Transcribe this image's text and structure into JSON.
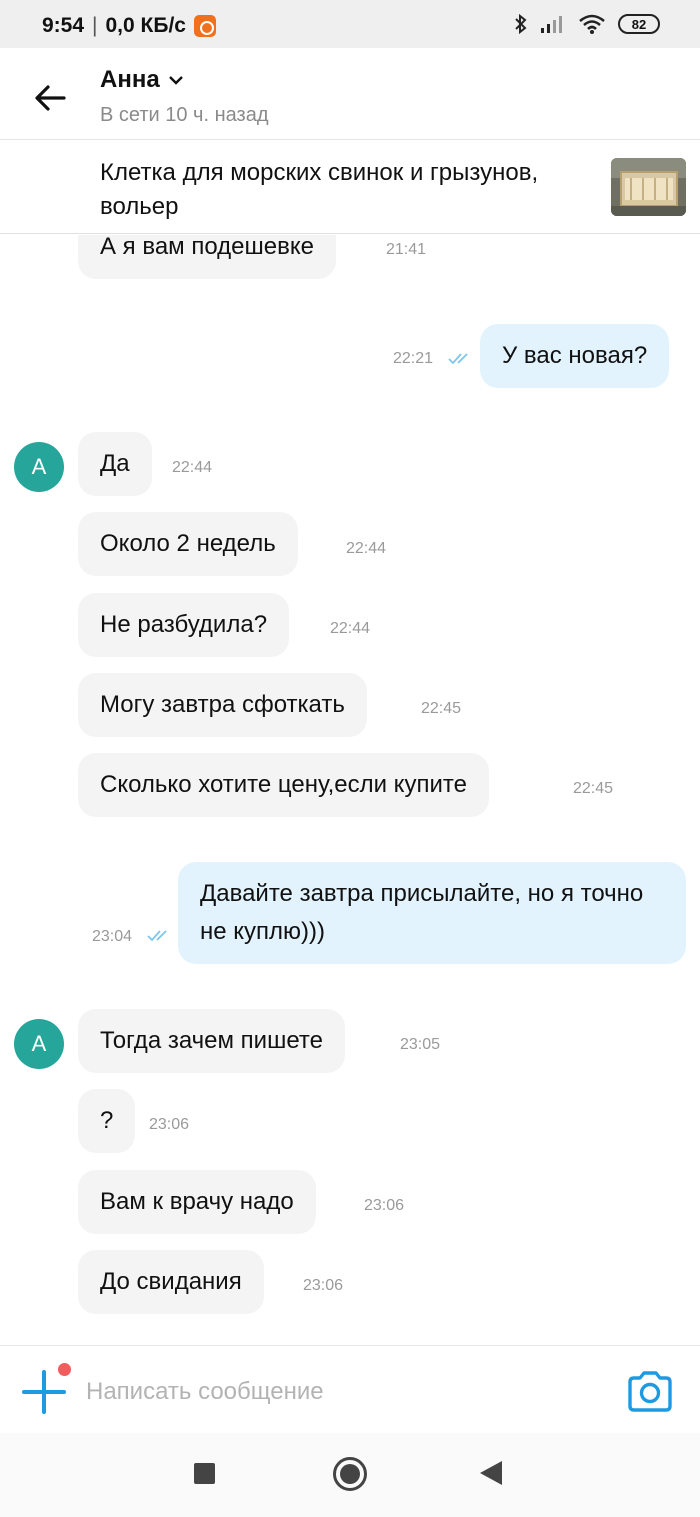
{
  "status_bar": {
    "time": "9:54",
    "network_speed": "0,0 КБ/с",
    "battery": "82"
  },
  "header": {
    "contact_name": "Анна",
    "contact_status": "В сети 10 ч. назад"
  },
  "listing": {
    "title": "Клетка для морских свинок и грызунов, вольер"
  },
  "messages": [
    {
      "text": "А я вам подешевке",
      "time": "21:41",
      "direction": "in"
    },
    {
      "text": "У вас новая?",
      "time": "22:21",
      "direction": "out"
    },
    {
      "avatar": "А",
      "text": "Да",
      "time": "22:44",
      "direction": "in"
    },
    {
      "text": "Около 2 недель",
      "time": "22:44",
      "direction": "in"
    },
    {
      "text": "Не разбудила?",
      "time": "22:44",
      "direction": "in"
    },
    {
      "text": "Могу завтра сфоткать",
      "time": "22:45",
      "direction": "in"
    },
    {
      "text": "Сколько хотите цену,если купите",
      "time": "22:45",
      "direction": "in"
    },
    {
      "text": "Давайте завтра присылайте, но я точно не куплю)))",
      "time": "23:04",
      "direction": "out"
    },
    {
      "avatar": "А",
      "text": "Тогда зачем пишете",
      "time": "23:05",
      "direction": "in"
    },
    {
      "text": "?",
      "time": "23:06",
      "direction": "in"
    },
    {
      "text": "Вам к врачу надо",
      "time": "23:06",
      "direction": "in"
    },
    {
      "text": "До свидания",
      "time": "23:06",
      "direction": "in"
    }
  ],
  "input": {
    "placeholder": "Написать сообщение"
  },
  "colors": {
    "accent": "#1e9be0",
    "avatar": "#26a69a",
    "incoming_bubble": "#f4f4f4",
    "outgoing_bubble": "#e2f3fd",
    "notification_dot": "#f25c5c"
  },
  "icons": [
    "back-arrow-icon",
    "chevron-down-icon",
    "double-check-icon",
    "plus-icon",
    "camera-icon",
    "bluetooth-icon",
    "signal-icon",
    "wifi-icon"
  ]
}
